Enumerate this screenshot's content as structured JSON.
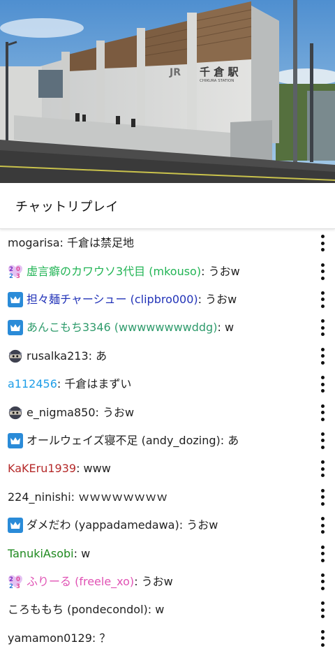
{
  "video": {
    "station_sign_kanji": "千 倉 駅",
    "station_sign_latin": "CHIKURA STATION",
    "jr_logo": "JR"
  },
  "header": {
    "title": "チャットリプレイ"
  },
  "colors": {
    "crown_badge_bg": "#2a8bd8",
    "green": "#1fa34a",
    "blue": "#2a3fbf",
    "teal": "#2f9b6c",
    "sky": "#1e9ee8",
    "red": "#b52a2a",
    "pink": "#e052b4",
    "forest": "#1f8a1f"
  },
  "messages": [
    {
      "badge": "none",
      "badge_icon": "",
      "author": "mogarisa",
      "author_color": "#1f1f1f",
      "text": "千倉は禁足地"
    },
    {
      "badge": "year",
      "badge_icon": "2023-badge-icon",
      "author": "虚言癖のカワウソ3代目 (mkouso)",
      "author_color": "#22b455",
      "text": "うおw"
    },
    {
      "badge": "crown",
      "badge_icon": "crown-icon",
      "author": "担々麺チャーシュー (clipbro000)",
      "author_color": "#2233b8",
      "text": "うおw"
    },
    {
      "badge": "crown",
      "badge_icon": "crown-icon",
      "author": "あんこもち3346 (wwwwwwwwddg)",
      "author_color": "#2f9b6c",
      "text": "w"
    },
    {
      "badge": "ninja",
      "badge_icon": "ninja-icon",
      "author": "rusalka213",
      "author_color": "#1f1f1f",
      "text": "あ"
    },
    {
      "badge": "none",
      "badge_icon": "",
      "author": "a112456",
      "author_color": "#1e9ee8",
      "text": "千倉はまずい"
    },
    {
      "badge": "ninja",
      "badge_icon": "ninja-icon",
      "author": "e_nigma850",
      "author_color": "#1f1f1f",
      "text": "うおw"
    },
    {
      "badge": "crown",
      "badge_icon": "crown-icon",
      "author": "オールウェイズ寝不足 (andy_dozing)",
      "author_color": "#1f1f1f",
      "text": "あ"
    },
    {
      "badge": "none",
      "badge_icon": "",
      "author": "KaKEru1939",
      "author_color": "#b52a2a",
      "text": "www"
    },
    {
      "badge": "none",
      "badge_icon": "",
      "author": "224_ninishi",
      "author_color": "#1f1f1f",
      "text": "ｗｗｗｗｗｗｗｗ"
    },
    {
      "badge": "crown",
      "badge_icon": "crown-icon",
      "author": "ダメだわ (yappadamedawa)",
      "author_color": "#1f1f1f",
      "text": "うおw"
    },
    {
      "badge": "none",
      "badge_icon": "",
      "author": "TanukiAsobi",
      "author_color": "#1f8a1f",
      "text": "w"
    },
    {
      "badge": "year",
      "badge_icon": "2023-badge-icon",
      "author": "ふりーる (freele_xo)",
      "author_color": "#e052b4",
      "text": "うおw"
    },
    {
      "badge": "none",
      "badge_icon": "",
      "author": "ころももち (pondecondol)",
      "author_color": "#1f1f1f",
      "text": "w"
    },
    {
      "badge": "none",
      "badge_icon": "",
      "author": "yamamon0129",
      "author_color": "#1f1f1f",
      "text": "？"
    }
  ],
  "message_separator": ": "
}
